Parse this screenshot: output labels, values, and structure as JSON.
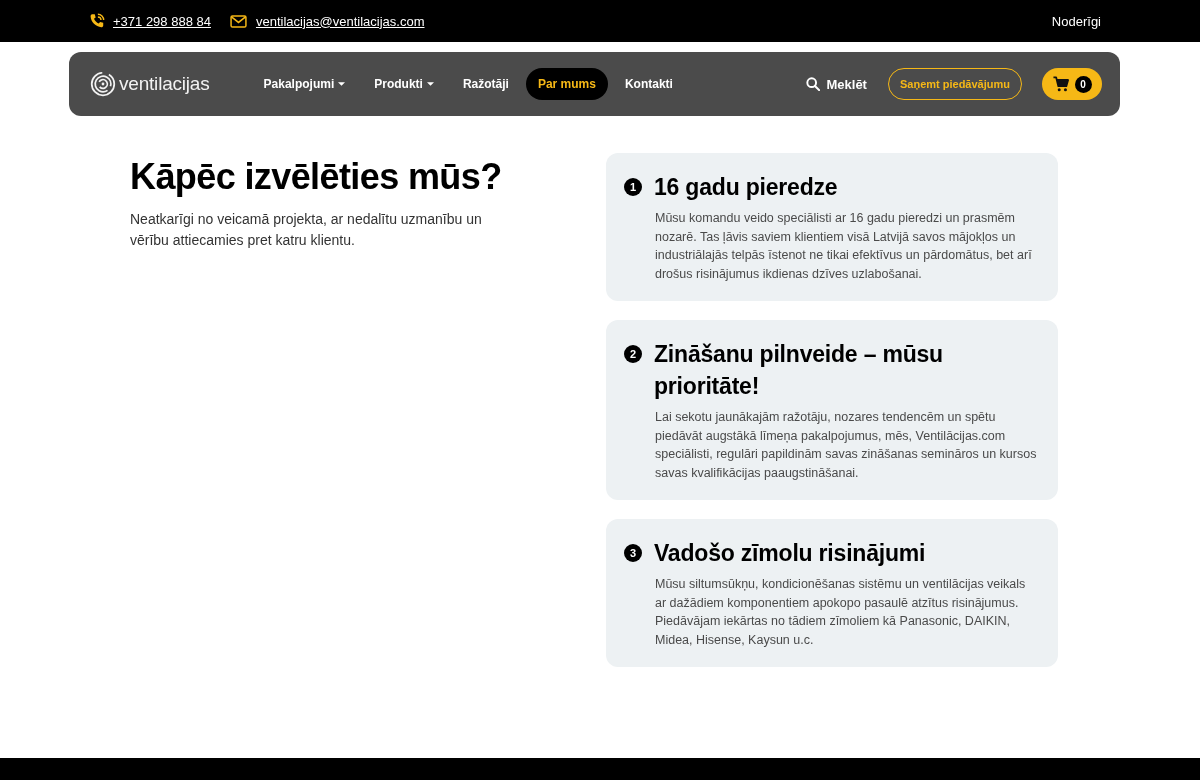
{
  "top_bar": {
    "phone": "+371 298 888 84",
    "email": "ventilacijas@ventilacijas.com",
    "links": [
      "Noderīgi"
    ]
  },
  "nav": {
    "logo": "ventilacijas",
    "items": [
      {
        "label": "Pakalpojumi",
        "dropdown": true,
        "selected": false
      },
      {
        "label": "Produkti",
        "dropdown": true,
        "selected": false
      },
      {
        "label": "Ražotāji",
        "dropdown": false,
        "selected": false
      },
      {
        "label": "Par mums",
        "dropdown": false,
        "selected": true
      },
      {
        "label": "Kontakti",
        "dropdown": false,
        "selected": false
      }
    ],
    "search": "Meklēt",
    "quote_button": "Saņemt piedāvājumu",
    "cart_count": "0"
  },
  "intro": {
    "title": "Kāpēc izvēlēties mūs?",
    "text": "Neatkarīgi no veicamā projekta, ar nedalītu uzmanību un vērību attiecamies pret katru klientu."
  },
  "features": [
    {
      "number": "1",
      "title": "16 gadu pieredze",
      "text": "Mūsu komandu veido speciālisti ar 16 gadu pieredzi un prasmēm nozarē. Tas ļāvis saviem klientiem visā Latvijā savos mājokļos un industriālajās telpās īstenot ne tikai efektīvus un pārdomātus, bet arī drošus risinājumus ikdienas dzīves uzlabošanai."
    },
    {
      "number": "2",
      "title": "Zināšanu pilnveide – mūsu prioritāte!",
      "text": "Lai sekotu jaunākajām ražotāju, nozares tendencēm un spētu piedāvāt augstākā līmeņa pakalpojumus, mēs, Ventilācijas.com speciālisti, regulāri papildinām savas zināšanas semināros un kursos savas kvalifikācijas paaugstināšanai."
    },
    {
      "number": "3",
      "title": "Vadošo zīmolu risinājumi",
      "text": "Mūsu siltumsūkņu, kondicionēšanas sistēmu un ventilācijas veikals ar dažādiem komponentiem apokopo pasaulē atzītus risinājumus. Piedāvājam iekārtas no tādiem zīmoliem kā Panasonic, DAIKIN, Midea, Hisense, Kaysun u.c."
    }
  ]
}
